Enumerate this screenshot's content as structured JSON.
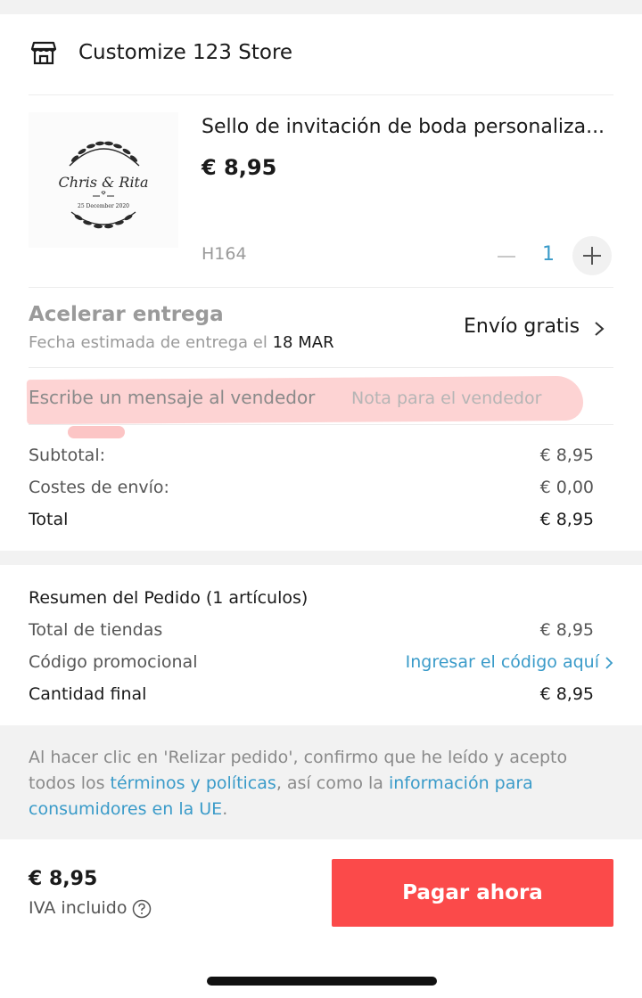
{
  "store": {
    "name": "Customize 123 Store",
    "icon": "store-icon"
  },
  "product": {
    "title": "Sello de invitación de boda personaliza...",
    "price": "€ 8,95",
    "sku": "H164",
    "quantity": "1",
    "image": {
      "name_line": "Chris & Rita",
      "date_line": "25 December 2020"
    }
  },
  "delivery": {
    "title": "Acelerar entrega",
    "subtitle_prefix": "Fecha estimada de entrega el",
    "date": "18 MAR",
    "shipping": "Envío gratis"
  },
  "message": {
    "label": "Escribe un mensaje al vendedor",
    "placeholder": "Nota para el vendedor"
  },
  "summary": {
    "rows": [
      {
        "label": "Subtotal:",
        "value": "€ 8,95"
      },
      {
        "label": "Costes de envío:",
        "value": "€ 0,00"
      },
      {
        "label": "Total",
        "value": "€ 8,95"
      }
    ]
  },
  "order": {
    "title": "Resumen del Pedido (1 artículos)",
    "stores_label": "Total de tiendas",
    "stores_value": "€ 8,95",
    "promo_label": "Código promocional",
    "promo_link": "Ingresar el código aquí",
    "final_label": "Cantidad final",
    "final_value": "€ 8,95"
  },
  "legal": {
    "part1": "Al hacer clic en 'Relizar pedido', confirmo que he leído y acepto todos los ",
    "link1": "términos y políticas",
    "part2": ", así como la ",
    "link2": "información para consumidores en la UE",
    "part3": "."
  },
  "footer": {
    "price": "€ 8,95",
    "vat": "IVA incluido",
    "pay_label": "Pagar ahora"
  },
  "colors": {
    "accent_blue": "#3a9bc9",
    "pay_red": "#fb4a4a",
    "highlight": "#fa9696"
  }
}
